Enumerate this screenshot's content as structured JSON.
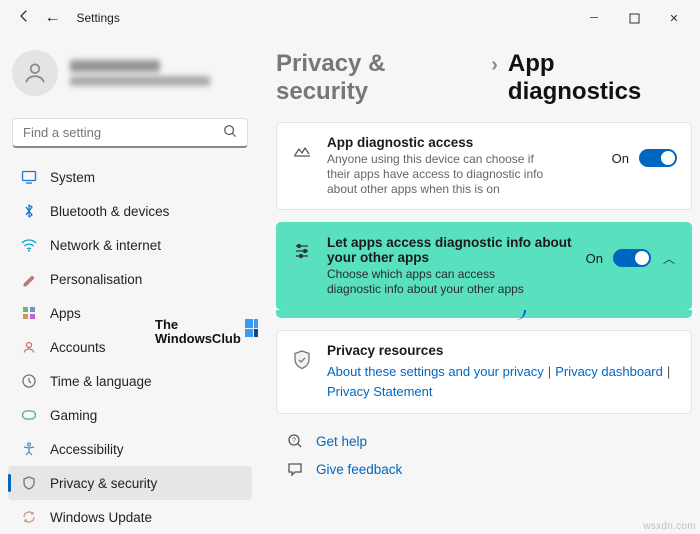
{
  "window": {
    "title": "Settings"
  },
  "profile": {
    "name": "██████",
    "email": "████████████████"
  },
  "search": {
    "placeholder": "Find a setting"
  },
  "sidebar": {
    "items": [
      {
        "label": "System"
      },
      {
        "label": "Bluetooth & devices"
      },
      {
        "label": "Network & internet"
      },
      {
        "label": "Personalisation"
      },
      {
        "label": "Apps"
      },
      {
        "label": "Accounts"
      },
      {
        "label": "Time & language"
      },
      {
        "label": "Gaming"
      },
      {
        "label": "Accessibility"
      },
      {
        "label": "Privacy & security"
      },
      {
        "label": "Windows Update"
      }
    ]
  },
  "breadcrumb": {
    "parent": "Privacy & security",
    "sep": "›",
    "current": "App diagnostics"
  },
  "cards": {
    "access": {
      "title": "App diagnostic access",
      "desc": "Anyone using this device can choose if their apps have access to diagnostic info about other apps when this is on",
      "state": "On"
    },
    "letapps": {
      "title": "Let apps access diagnostic info about your other apps",
      "desc": "Choose which apps can access diagnostic info about your other apps",
      "state": "On"
    },
    "privres": {
      "title": "Privacy resources",
      "link1": "About these settings and your privacy",
      "link2": "Privacy dashboard",
      "link3": "Privacy Statement"
    }
  },
  "help": {
    "get": "Get help",
    "feedback": "Give feedback"
  },
  "watermark": {
    "line1": "The",
    "line2": "WindowsClub"
  },
  "footer": {
    "url": "wsxdn.com"
  }
}
